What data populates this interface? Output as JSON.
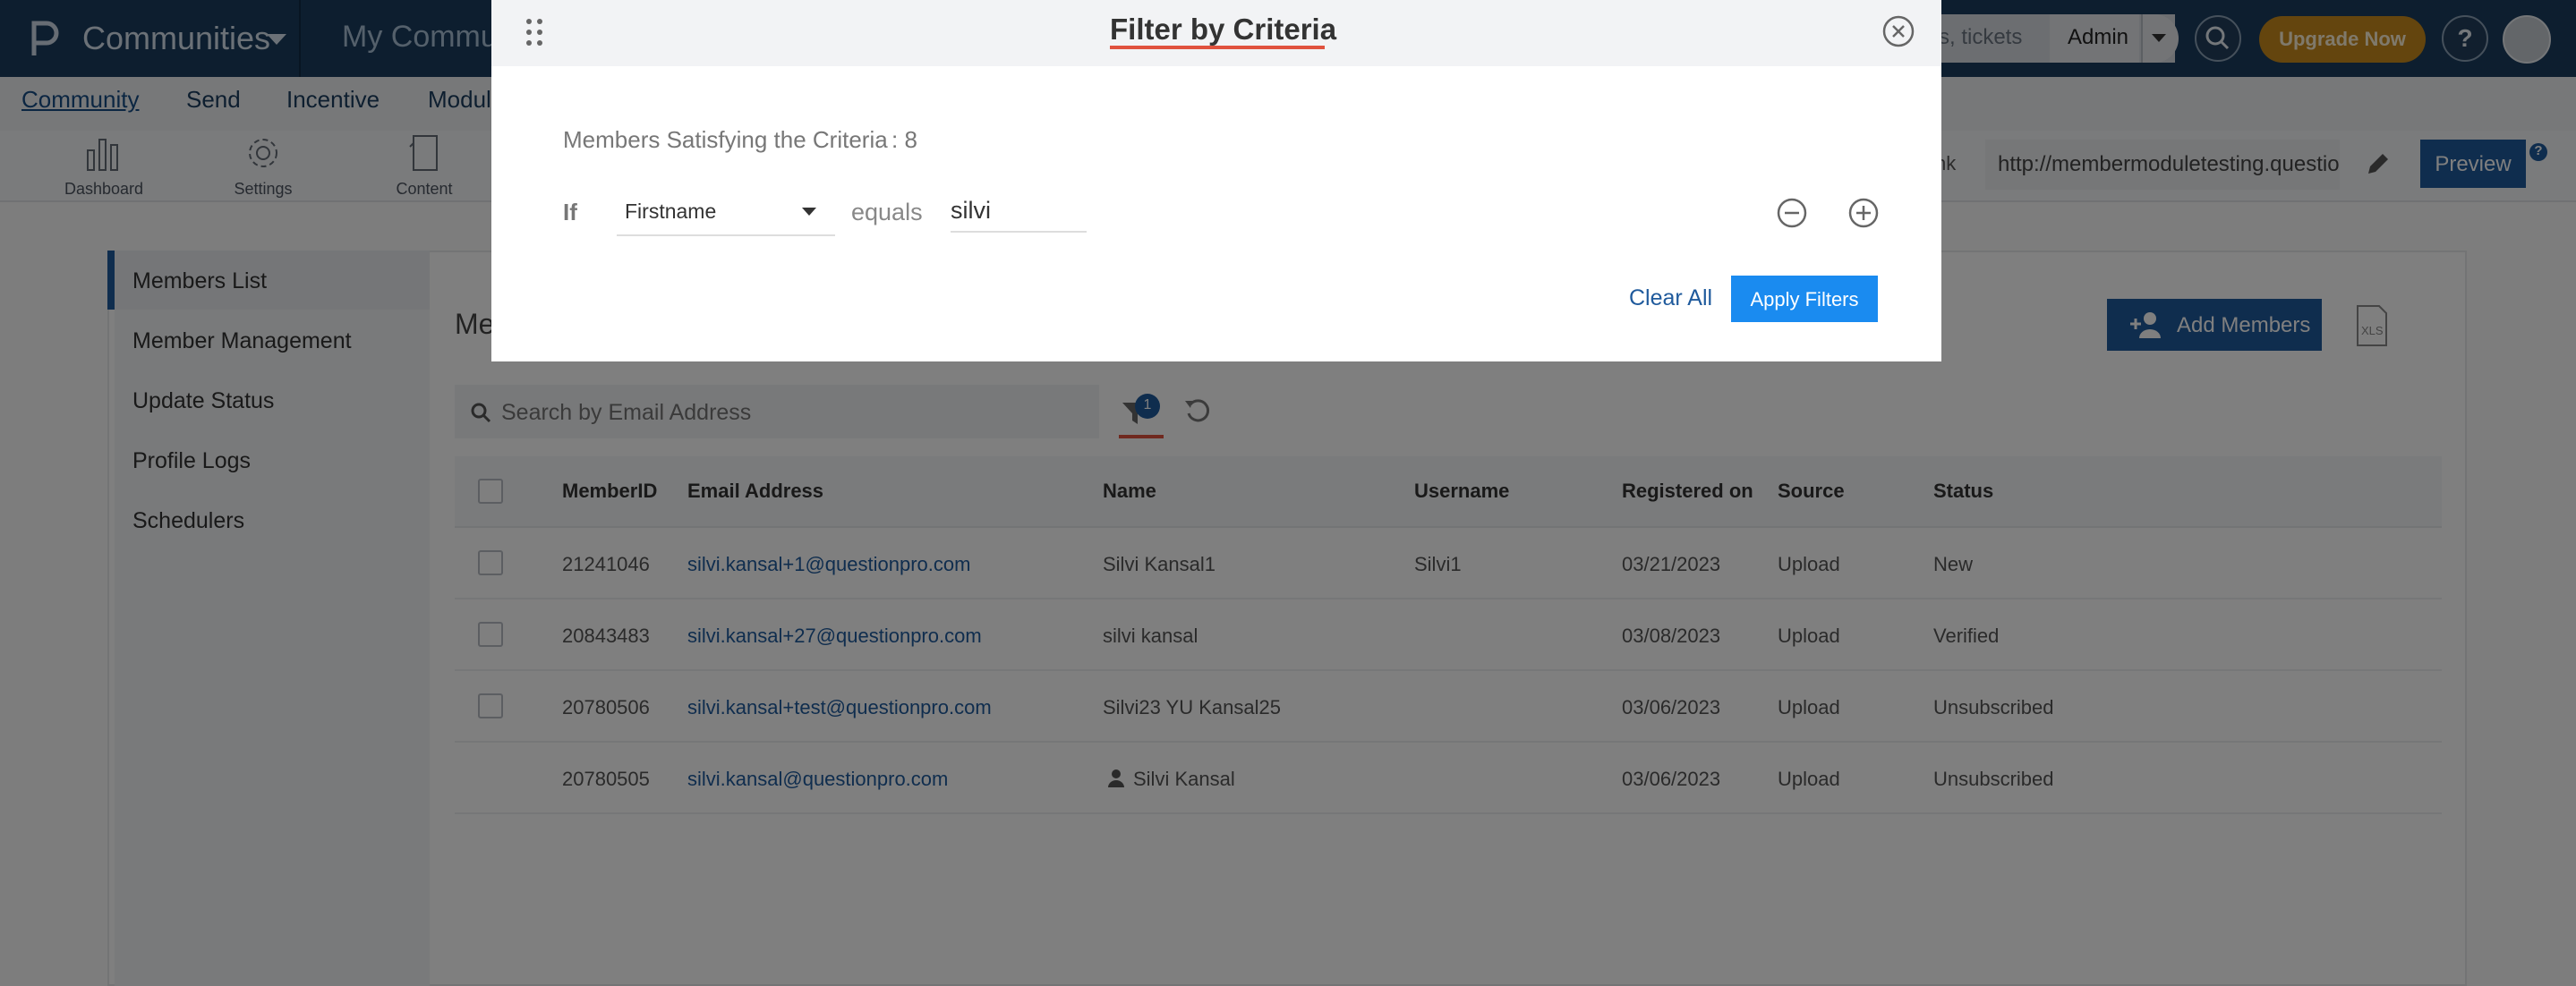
{
  "header": {
    "app_name": "Communities",
    "project_name": "My Community",
    "search_placeholder": "s, tickets",
    "user_menu": "Admin",
    "upgrade_label": "Upgrade Now",
    "help_glyph": "?"
  },
  "nav": {
    "items": [
      {
        "label": "Community",
        "active": true
      },
      {
        "label": "Send"
      },
      {
        "label": "Incentive"
      },
      {
        "label": "Modules"
      }
    ]
  },
  "toolbar": {
    "tools": [
      {
        "label": "Dashboard",
        "icon": "bar-chart-icon"
      },
      {
        "label": "Settings",
        "icon": "gear-icon"
      },
      {
        "label": "Content",
        "icon": "document-icon"
      }
    ],
    "url_label": "nk",
    "url_value": "http://membermoduletesting.questio",
    "preview_label": "Preview",
    "help_glyph": "?"
  },
  "sidebar": {
    "items": [
      {
        "label": "Members List",
        "active": true
      },
      {
        "label": "Member Management"
      },
      {
        "label": "Update Status"
      },
      {
        "label": "Profile Logs"
      },
      {
        "label": "Schedulers"
      }
    ]
  },
  "main": {
    "title": "Me",
    "add_members_label": "Add Members",
    "search_placeholder": "Search by Email Address",
    "filter_count": "1",
    "table": {
      "columns": [
        "MemberID",
        "Email Address",
        "Name",
        "Username",
        "Registered on",
        "Source",
        "Status"
      ],
      "rows": [
        {
          "id": "21241046",
          "email": "silvi.kansal+1@questionpro.com",
          "name": "Silvi Kansal1",
          "username": "Silvi1",
          "registered": "03/21/2023",
          "source": "Upload",
          "status": "New"
        },
        {
          "id": "20843483",
          "email": "silvi.kansal+27@questionpro.com",
          "name": "silvi kansal",
          "username": "",
          "registered": "03/08/2023",
          "source": "Upload",
          "status": "Verified"
        },
        {
          "id": "20780506",
          "email": "silvi.kansal+test@questionpro.com",
          "name": "Silvi23 YU Kansal25",
          "username": "",
          "registered": "03/06/2023",
          "source": "Upload",
          "status": "Unsubscribed"
        },
        {
          "id": "20780505",
          "email": "silvi.kansal@questionpro.com",
          "name": "Silvi Kansal",
          "username": "",
          "registered": "03/06/2023",
          "source": "Upload",
          "status": "Unsubscribed"
        }
      ]
    }
  },
  "modal": {
    "title": "Filter by Criteria",
    "criteria_label": "Members Satisfying the Criteria",
    "criteria_count": ": 8",
    "if_label": "If",
    "field_value": "Firstname",
    "operator": "equals",
    "value": "silvi",
    "clear_label": "Clear All",
    "apply_label": "Apply Filters"
  },
  "colors": {
    "header_bg": "#1b3d5e",
    "accent": "#1f5a9c",
    "apply_button": "#1a8bf0",
    "upgrade": "#c98a1c",
    "highlight": "#e0523e"
  }
}
